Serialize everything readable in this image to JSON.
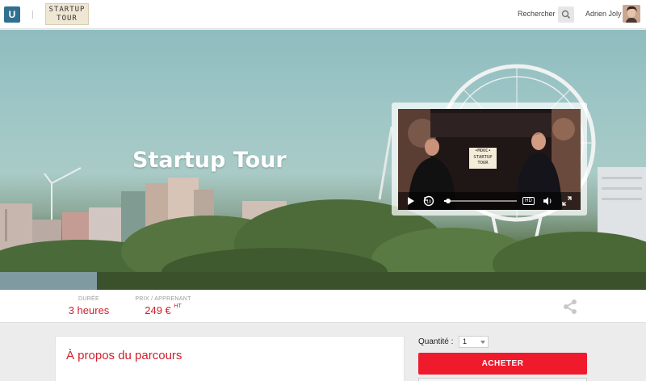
{
  "topbar": {
    "logo_letter": "U",
    "brand_line1": "STARTUP",
    "brand_line2": "TOUR",
    "search_label": "Rechercher",
    "user_name": "Adrien Joly"
  },
  "hero": {
    "title": "Startup Tour",
    "video_sign_line1": "•MOOC•",
    "video_sign_line2": "STARTUP",
    "video_sign_line3": "TOUR",
    "video_playback_progress": 0.05,
    "video_quality_label": "HD"
  },
  "info": {
    "duration_label": "DURÉE",
    "duration_value": "3 heures",
    "price_label": "PRIX / APPRENANT",
    "price_value": "249 €",
    "price_suffix": "HT"
  },
  "about": {
    "title": "À propos du parcours"
  },
  "purchase": {
    "quantity_label": "Quantité :",
    "quantity_value": "1",
    "buy_label": "ACHETER"
  },
  "colors": {
    "accent": "#ef1b2d",
    "accent_text": "#d0202c",
    "logo_bg": "#2f6f8f"
  },
  "icons": [
    "search-icon",
    "share-icon",
    "play-icon",
    "replay-10-icon",
    "volume-icon",
    "fullscreen-icon"
  ]
}
